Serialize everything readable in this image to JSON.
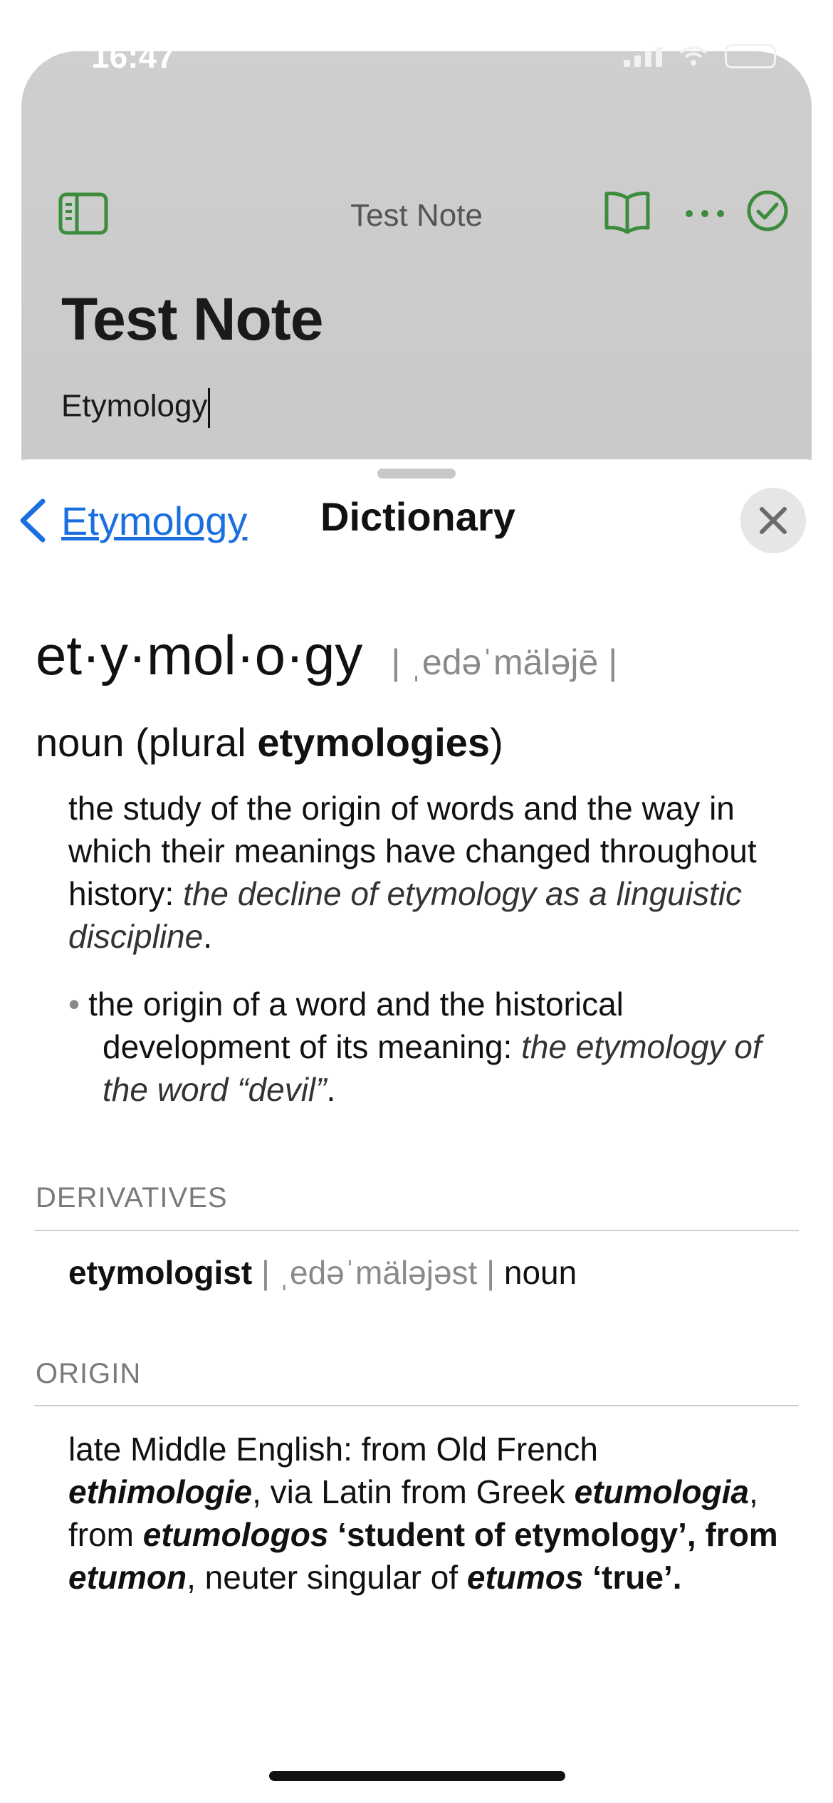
{
  "status_bar": {
    "time": "16:47"
  },
  "note": {
    "toolbar_title": "Test Note",
    "heading": "Test Note",
    "body": "Etymology"
  },
  "colors": {
    "accent_green": "#3d8c3d",
    "link_blue": "#1a6fe0"
  },
  "icons": {
    "sidebar": "sidebar-icon",
    "reader": "book-icon",
    "more": "ellipsis-icon",
    "done": "checkmark-circle-icon",
    "back": "chevron-left-icon",
    "close": "close-icon"
  },
  "sheet": {
    "back_label": "Etymology",
    "title": "Dictionary"
  },
  "entry": {
    "headword": "et·y·mol·o·gy",
    "pronunciation": "| ˌedəˈmäləjē |",
    "pos_prefix": "noun (plural ",
    "plural": "etymologies",
    "pos_suffix": ")",
    "sense1_text": "the study of the origin of words and the way in which their meanings have changed throughout history: ",
    "sense1_example": "the decline of etymology as a linguistic discipline",
    "sense1_end": ".",
    "sense2_bullet": "•",
    "sense2_text": "the origin of a word and the historical development of its meaning: ",
    "sense2_example": "the etymology of the word “devil”",
    "sense2_end": "."
  },
  "derivatives": {
    "label": "DERIVATIVES",
    "word": "etymologist",
    "pronunciation": "| ˌedəˈmäləjəst |",
    "pos": "noun"
  },
  "origin": {
    "label": "ORIGIN",
    "t1": "late Middle English: from Old French ",
    "w1": "ethimologie",
    "t2": ", via Latin from Greek ",
    "w2": "etumologia",
    "t3": ", from ",
    "w3": "etumologos",
    "t4": " ‘student of etymology’, from ",
    "w4": "etumon",
    "t5": ", neuter singular of ",
    "w5": "etumos",
    "t6": " ‘true’."
  }
}
